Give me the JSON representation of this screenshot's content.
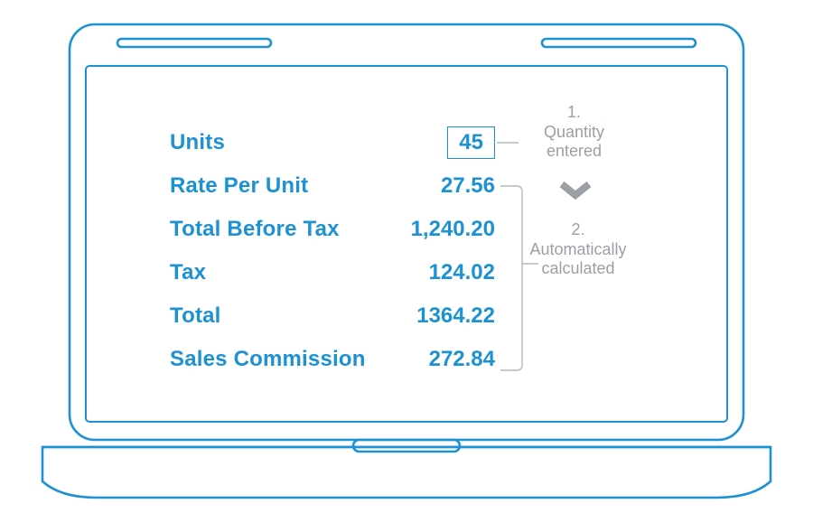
{
  "rows": [
    {
      "label": "Units",
      "value": "45",
      "boxed": true
    },
    {
      "label": "Rate Per Unit",
      "value": "27.56",
      "boxed": false
    },
    {
      "label": "Total Before Tax",
      "value": "1,240.20",
      "boxed": false
    },
    {
      "label": "Tax",
      "value": "124.02",
      "boxed": false
    },
    {
      "label": "Total",
      "value": "1364.22",
      "boxed": false
    },
    {
      "label": "Sales Commission",
      "value": "272.84",
      "boxed": false
    }
  ],
  "annotations": {
    "first_num": "1.",
    "first_line1": "Quantity",
    "first_line2": "entered",
    "second_num": "2.",
    "second_line1": "Automatically",
    "second_line2": "calculated"
  },
  "colors": {
    "accent": "#1c91d3",
    "muted": "#9b9fa4",
    "connector": "#b4b8bd"
  }
}
